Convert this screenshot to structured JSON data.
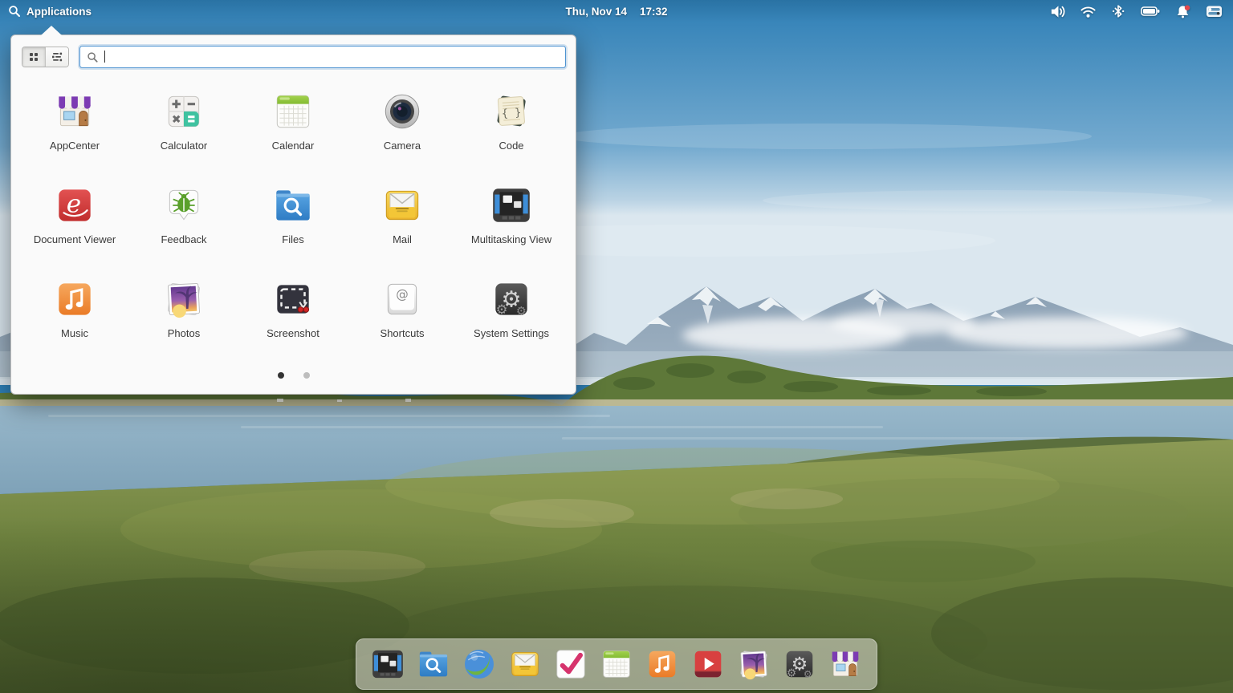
{
  "panel": {
    "applications_label": "Applications",
    "applications_icon": "search-icon",
    "clock": {
      "date": "Thu, Nov 14",
      "time": "17:32"
    },
    "indicators": [
      {
        "name": "volume-icon"
      },
      {
        "name": "wifi-icon"
      },
      {
        "name": "bluetooth-icon"
      },
      {
        "name": "battery-icon"
      },
      {
        "name": "notifications-icon",
        "badge": true,
        "badge_color": "#e2484d"
      },
      {
        "name": "session-icon"
      }
    ]
  },
  "launcher": {
    "toolbar": {
      "view_toggles": [
        {
          "name": "grid-view-icon",
          "active": true
        },
        {
          "name": "list-view-icon",
          "active": false
        }
      ],
      "search": {
        "value": "",
        "placeholder": "",
        "icon": "search-icon"
      }
    },
    "apps": [
      {
        "label": "AppCenter",
        "icon": "appcenter-icon"
      },
      {
        "label": "Calculator",
        "icon": "calculator-icon"
      },
      {
        "label": "Calendar",
        "icon": "calendar-icon"
      },
      {
        "label": "Camera",
        "icon": "camera-icon"
      },
      {
        "label": "Code",
        "icon": "code-icon"
      },
      {
        "label": "Document Viewer",
        "icon": "document-viewer-icon"
      },
      {
        "label": "Feedback",
        "icon": "feedback-icon"
      },
      {
        "label": "Files",
        "icon": "files-icon"
      },
      {
        "label": "Mail",
        "icon": "mail-icon"
      },
      {
        "label": "Multitasking View",
        "icon": "multitasking-view-icon"
      },
      {
        "label": "Music",
        "icon": "music-icon"
      },
      {
        "label": "Photos",
        "icon": "photos-icon"
      },
      {
        "label": "Screenshot",
        "icon": "screenshot-icon"
      },
      {
        "label": "Shortcuts",
        "icon": "shortcuts-icon"
      },
      {
        "label": "System Settings",
        "icon": "system-settings-icon"
      }
    ],
    "pagination": {
      "total_pages": 2,
      "active_page": 1
    }
  },
  "dock": {
    "items": [
      {
        "name": "multitasking-view-icon"
      },
      {
        "name": "files-icon"
      },
      {
        "name": "web-browser-icon"
      },
      {
        "name": "mail-icon"
      },
      {
        "name": "tasks-icon"
      },
      {
        "name": "calendar-icon"
      },
      {
        "name": "music-icon"
      },
      {
        "name": "videos-icon"
      },
      {
        "name": "photos-icon"
      },
      {
        "name": "system-settings-icon"
      },
      {
        "name": "appcenter-icon"
      }
    ]
  },
  "colors": {
    "accent_blue": "#3689e6",
    "launcher_bg": "#fafafa",
    "panel_text": "#ffffff",
    "sky_top": "#2e7fb6",
    "notification_badge": "#e2484d"
  }
}
